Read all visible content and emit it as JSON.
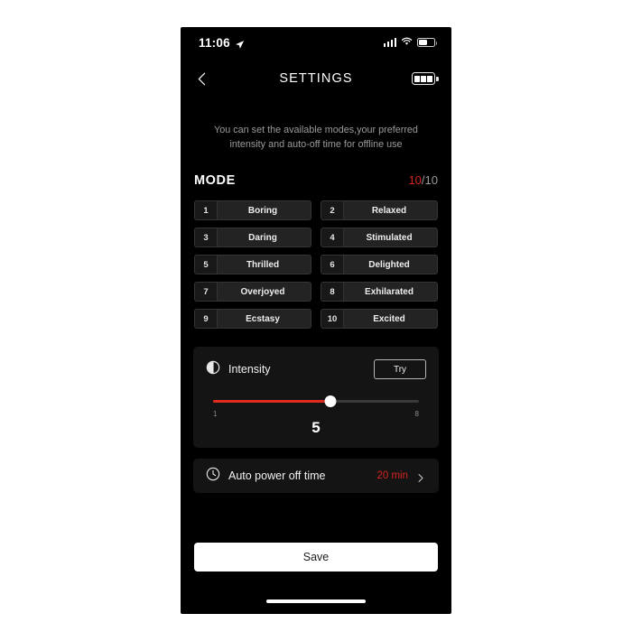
{
  "status_bar": {
    "time": "11:06",
    "location_icon": "location-arrow-icon",
    "signal_icon": "cellular-signal-icon",
    "wifi_icon": "wifi-icon",
    "battery_icon": "battery-icon"
  },
  "header": {
    "back_icon": "chevron-left-icon",
    "title": "SETTINGS",
    "device_battery_icon": "device-battery-icon"
  },
  "description": "You can set the available modes,your preferred intensity and auto-off time for offline use",
  "mode_section": {
    "title": "MODE",
    "count_current": "10",
    "count_total": "/10",
    "modes": [
      {
        "num": "1",
        "label": "Boring"
      },
      {
        "num": "2",
        "label": "Relaxed"
      },
      {
        "num": "3",
        "label": "Daring"
      },
      {
        "num": "4",
        "label": "Stimulated"
      },
      {
        "num": "5",
        "label": "Thrilled"
      },
      {
        "num": "6",
        "label": "Delighted"
      },
      {
        "num": "7",
        "label": "Overjoyed"
      },
      {
        "num": "8",
        "label": "Exhilarated"
      },
      {
        "num": "9",
        "label": "Ecstasy"
      },
      {
        "num": "10",
        "label": "Excited"
      }
    ]
  },
  "intensity": {
    "icon": "contrast-half-circle-icon",
    "label": "Intensity",
    "try_label": "Try",
    "min_label": "1",
    "max_label": "8",
    "value": "5",
    "fill_percent": 57
  },
  "auto_power_off": {
    "icon": "clock-icon",
    "label": "Auto power off time",
    "value": "20 min",
    "chevron_icon": "chevron-right-icon"
  },
  "save": {
    "label": "Save"
  },
  "colors": {
    "accent_red": "#d6241f",
    "slider_red": "#e02b20",
    "page_bg": "#000000",
    "card_bg": "#141414",
    "mode_btn_bg": "#232323",
    "mode_num_bg": "#181818"
  }
}
